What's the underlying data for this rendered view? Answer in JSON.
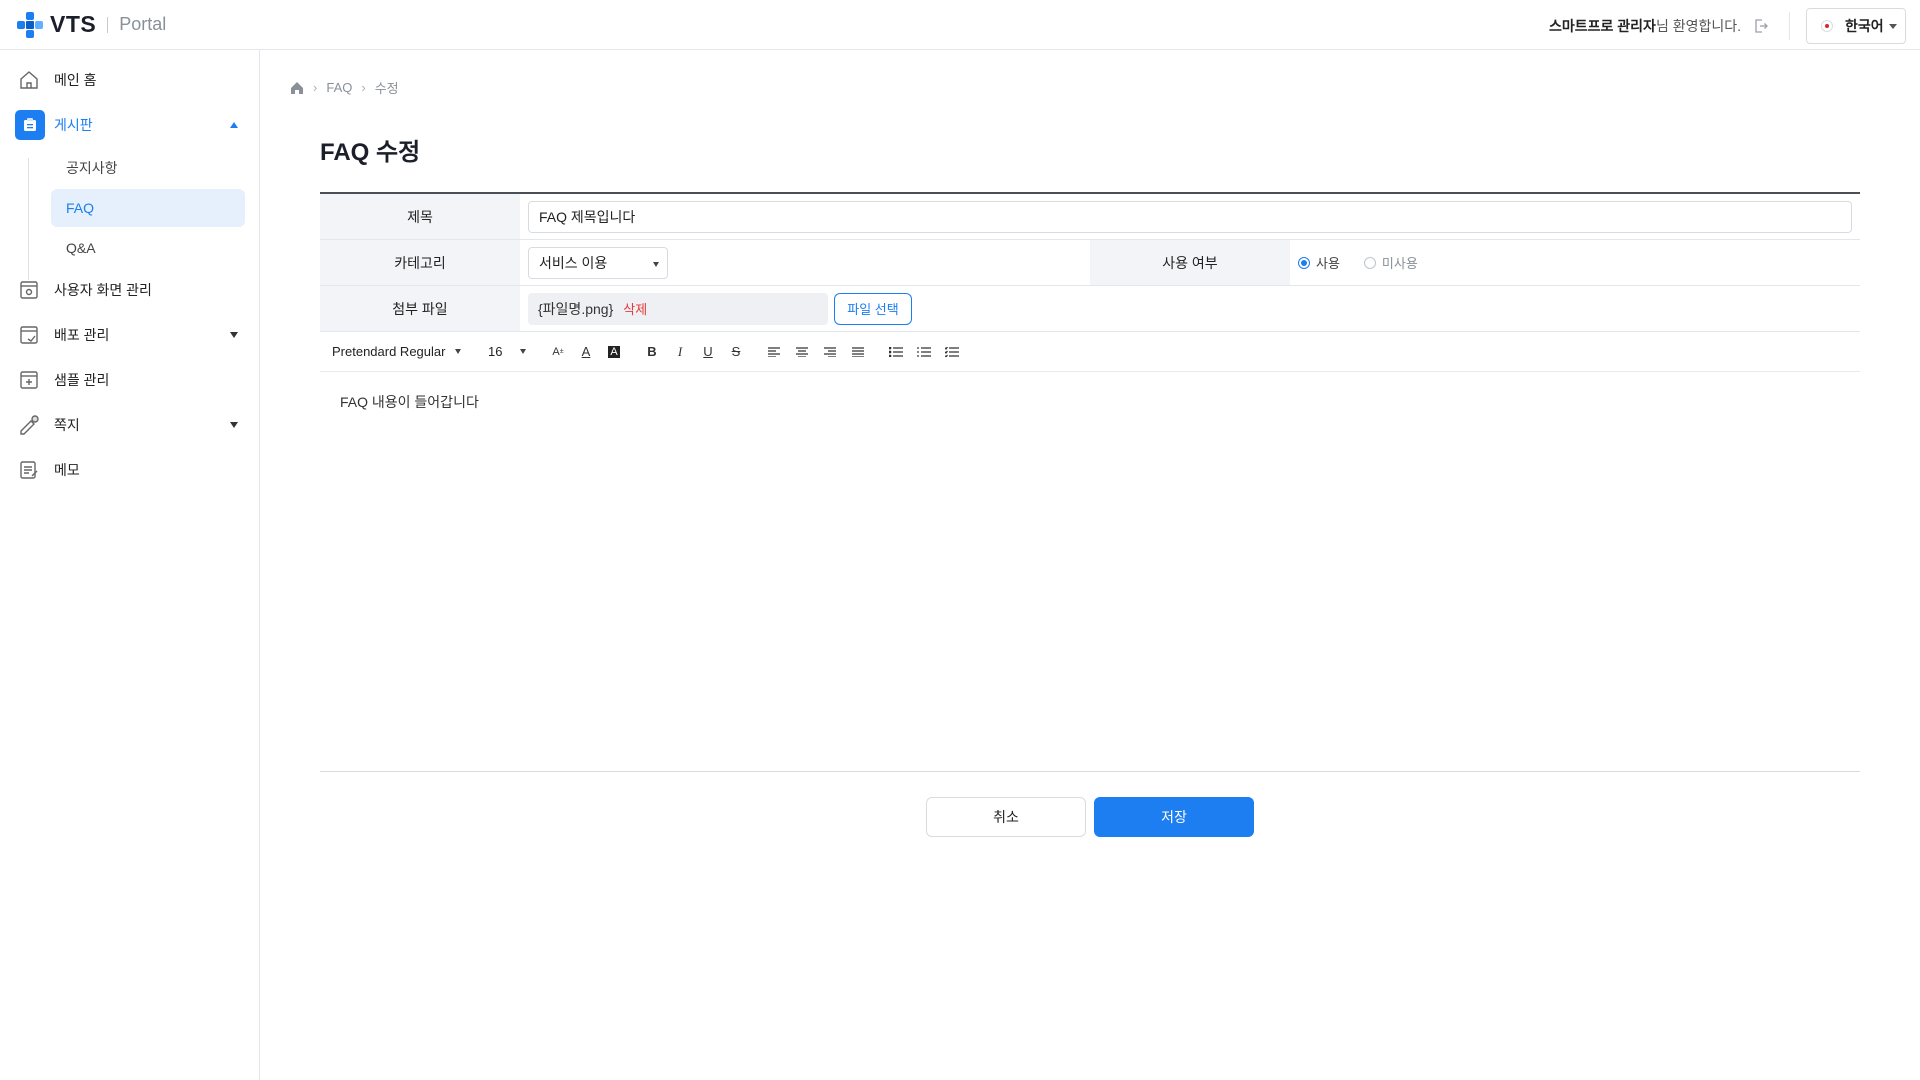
{
  "header": {
    "logo_text": "VTS",
    "portal_text": "Portal",
    "user_name": "스마트프로 관리자",
    "welcome_suffix": "님 환영합니다.",
    "language": "한국어"
  },
  "sidebar": {
    "items": [
      {
        "label": "메인 홈",
        "icon": "home-icon"
      },
      {
        "label": "게시판",
        "icon": "board-icon",
        "expanded": true
      },
      {
        "label": "사용자 화면 관리",
        "icon": "screen-settings-icon"
      },
      {
        "label": "배포 관리",
        "icon": "deploy-icon"
      },
      {
        "label": "샘플 관리",
        "icon": "sample-icon"
      },
      {
        "label": "쪽지",
        "icon": "message-icon"
      },
      {
        "label": "메모",
        "icon": "memo-icon"
      }
    ],
    "sub_items": [
      {
        "label": "공지사항"
      },
      {
        "label": "FAQ",
        "active": true
      },
      {
        "label": "Q&A"
      }
    ]
  },
  "breadcrumb": {
    "items": [
      "FAQ",
      "수정"
    ]
  },
  "page": {
    "title": "FAQ 수정"
  },
  "form": {
    "title_label": "제목",
    "title_value": "FAQ 제목입니다",
    "category_label": "카테고리",
    "category_value": "서비스 이용",
    "usage_label": "사용 여부",
    "usage_on": "사용",
    "usage_off": "미사용",
    "attachment_label": "첨부 파일",
    "file_name": "{파일명.png}",
    "delete_label": "삭제",
    "file_select": "파일 선택"
  },
  "editor": {
    "font": "Pretendard Regular",
    "size": "16",
    "content": "FAQ 내용이 들어갑니다"
  },
  "actions": {
    "cancel": "취소",
    "save": "저장"
  },
  "colors": {
    "accent": "#1c7ef0",
    "danger": "#e53b3b",
    "header_bg": "#f2f4f7"
  }
}
